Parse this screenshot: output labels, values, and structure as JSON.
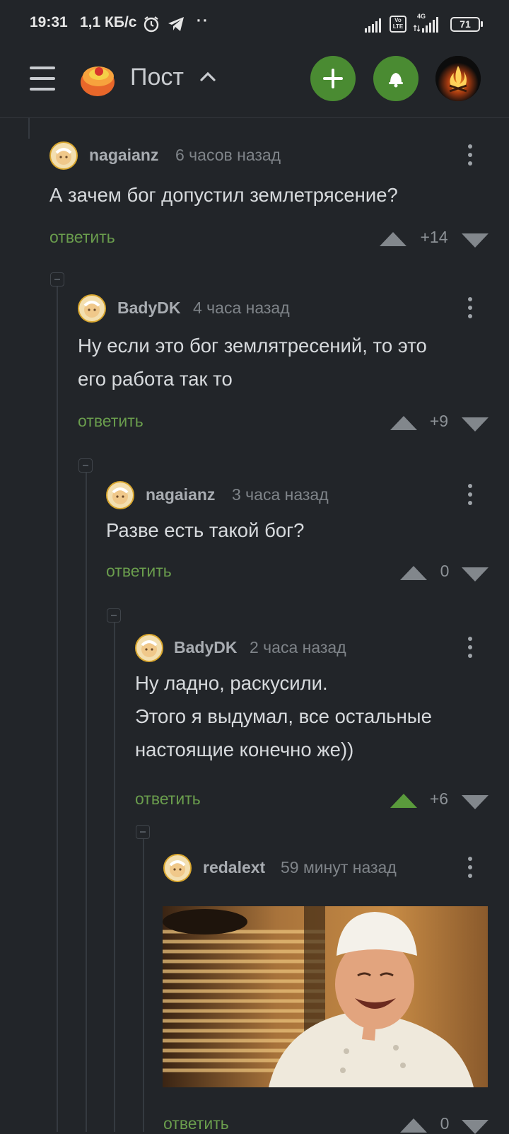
{
  "status": {
    "time": "19:31",
    "speed": "1,1 КБ/с",
    "battery": "71",
    "network_badge": "4G",
    "volte": "Vo LTE"
  },
  "header": {
    "title": "Пост",
    "menu_icon": "hamburger-icon",
    "logo_icon": "pikabu-logo",
    "add_icon": "plus-icon",
    "bell_icon": "bell-icon",
    "accent": "#4a8b32"
  },
  "comments": [
    {
      "author": "nagaianz",
      "time": "6 часов назад",
      "lines": [
        "А зачем бог допустил землетрясение?"
      ],
      "reply": "ответить",
      "score": "+14",
      "upvoted": false
    },
    {
      "author": "BadyDK",
      "time": "4 часа назад",
      "lines": [
        "Ну если это бог землятресений, то это",
        "его работа так то"
      ],
      "reply": "ответить",
      "score": "+9",
      "upvoted": false
    },
    {
      "author": "nagaianz",
      "time": "3 часа назад",
      "lines": [
        "Разве есть такой бог?"
      ],
      "reply": "ответить",
      "score": "0",
      "upvoted": false
    },
    {
      "author": "BadyDK",
      "time": "2 часа назад",
      "lines": [
        "Ну ладно, раскусили.",
        "Этого я выдумал, все остальные",
        "настоящие конечно же))"
      ],
      "reply": "ответить",
      "score": "+6",
      "upvoted": true
    },
    {
      "author": "redalext",
      "time": "59 минут назад",
      "lines": [],
      "image": "laughing-chef-photo",
      "reply": "ответить",
      "score": "0",
      "upvoted": false
    }
  ]
}
